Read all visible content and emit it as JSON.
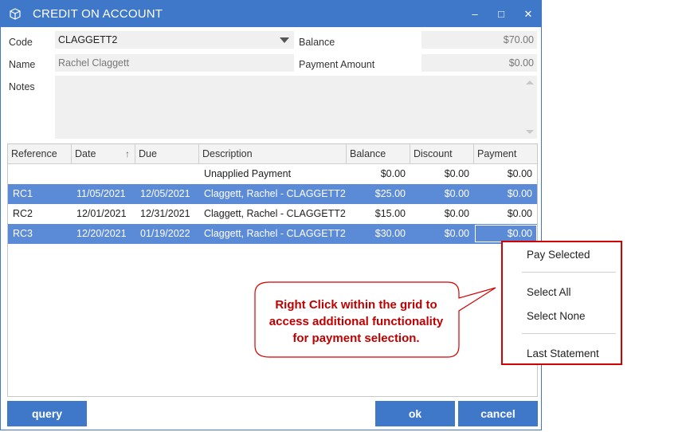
{
  "window": {
    "title": "CREDIT ON ACCOUNT",
    "minimize_glyph": "–",
    "maximize_glyph": "□",
    "close_glyph": "✕",
    "accent": "#3f78c9"
  },
  "form": {
    "code_label": "Code",
    "code_value": "CLAGGETT2",
    "name_label": "Name",
    "name_value": "Rachel Claggett",
    "notes_label": "Notes",
    "notes_value": "",
    "balance_label": "Balance",
    "balance_value": "$70.00",
    "payment_amount_label": "Payment Amount",
    "payment_amount_value": "$0.00"
  },
  "grid": {
    "columns": [
      "Reference",
      "Date",
      "Due",
      "Description",
      "Balance",
      "Discount",
      "Payment"
    ],
    "sort_icon": "arrow-up-icon",
    "rows": [
      {
        "reference": "",
        "date": "",
        "due": "",
        "description": "Unapplied Payment",
        "balance": "$0.00",
        "discount": "$0.00",
        "payment": "$0.00",
        "selected": false
      },
      {
        "reference": "RC1",
        "date": "11/05/2021",
        "due": "12/05/2021",
        "description": "Claggett, Rachel - CLAGGETT2",
        "balance": "$25.00",
        "discount": "$0.00",
        "payment": "$0.00",
        "selected": true
      },
      {
        "reference": "RC2",
        "date": "12/01/2021",
        "due": "12/31/2021",
        "description": "Claggett, Rachel - CLAGGETT2",
        "balance": "$15.00",
        "discount": "$0.00",
        "payment": "$0.00",
        "selected": false
      },
      {
        "reference": "RC3",
        "date": "12/20/2021",
        "due": "01/19/2022",
        "description": "Claggett, Rachel - CLAGGETT2",
        "balance": "$30.00",
        "discount": "$0.00",
        "payment": "$0.00",
        "selected": true
      }
    ],
    "selected_row_color": "#5b8ad6"
  },
  "buttons": {
    "query": "query",
    "ok": "ok",
    "cancel": "cancel"
  },
  "context_menu": {
    "pay_selected": "Pay Selected",
    "select_all": "Select All",
    "select_none": "Select None",
    "last_statement": "Last Statement",
    "border_color": "#d40000"
  },
  "callout": {
    "line1": "Right Click within the grid to",
    "line2": "access additional functionality",
    "line3": "for payment selection.",
    "color": "#c00000"
  }
}
